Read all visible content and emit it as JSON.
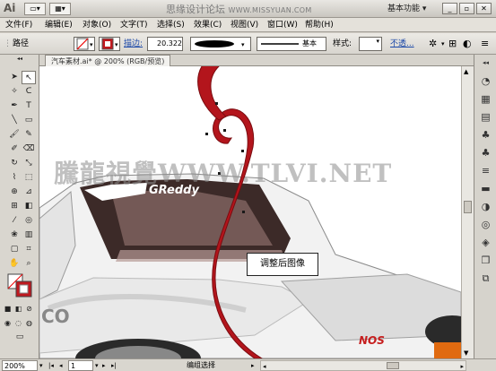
{
  "titlebar": {
    "app_logo": "Ai",
    "watermark": "思缘设计论坛",
    "watermark_latin": "WWW.MISSYUAN.COM",
    "workspace_preset": "基本功能 ▾"
  },
  "menus": [
    "文件(F)",
    "编辑(E)",
    "对象(O)",
    "文字(T)",
    "选择(S)",
    "效果(C)",
    "视图(V)",
    "窗口(W)",
    "帮助(H)"
  ],
  "controlbar": {
    "selection_label": "路径",
    "stroke_label": "描边:",
    "stroke_weight": "20.322",
    "brush_label": "基本",
    "style_label": "样式:",
    "opacity_label": "不透..."
  },
  "document": {
    "tab_title": "汽车素材.ai* @ 200% (RGB/预览)"
  },
  "canvas": {
    "watermark": "騰龍視覺WWW.TLVI.NET",
    "callout": "调整后图像",
    "windshield_brand": "GReddy",
    "car_badge_left": "CO",
    "car_badge_right": "NOS"
  },
  "statusbar": {
    "zoom": "200%",
    "page": "1",
    "status": "编组选择"
  },
  "colors": {
    "swirl": "#b3151c",
    "swirl_outline": "#7a0c10",
    "fill_swatch": "#ffffff",
    "stroke_swatch": "#c0191f"
  }
}
